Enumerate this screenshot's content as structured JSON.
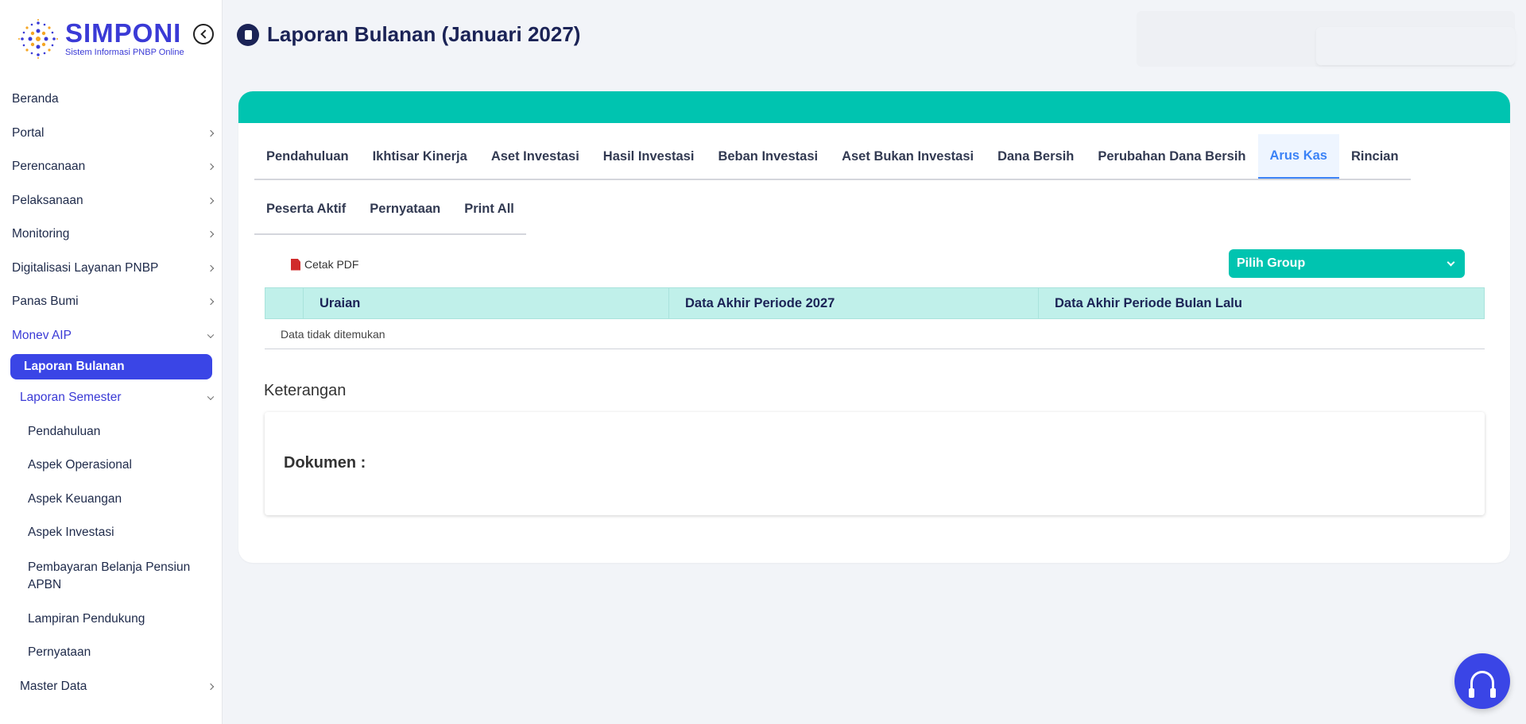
{
  "brand": {
    "title": "SIMPONI",
    "subtitle": "Sistem Informasi PNBP Online",
    "color": "#3a3ad6"
  },
  "sidebar": {
    "items": [
      {
        "label": "Beranda"
      },
      {
        "label": "Portal"
      },
      {
        "label": "Perencanaan"
      },
      {
        "label": "Pelaksanaan"
      },
      {
        "label": "Monitoring"
      },
      {
        "label": "Digitalisasi Layanan PNBP"
      },
      {
        "label": "Panas Bumi"
      },
      {
        "label": "Monev AIP"
      },
      {
        "label": "Laporan Bulanan"
      },
      {
        "label": "Laporan Semester"
      },
      {
        "label": "Pendahuluan"
      },
      {
        "label": "Aspek Operasional"
      },
      {
        "label": "Aspek Keuangan"
      },
      {
        "label": "Aspek Investasi"
      },
      {
        "label": "Pembayaran Belanja Pensiun APBN"
      },
      {
        "label": "Lampiran Pendukung"
      },
      {
        "label": "Pernyataan"
      },
      {
        "label": "Master Data"
      }
    ]
  },
  "header": {
    "title": "Laporan Bulanan (Januari 2027)"
  },
  "tabs": {
    "row1": [
      "Pendahuluan",
      "Ikhtisar Kinerja",
      "Aset Investasi",
      "Hasil Investasi",
      "Beban Investasi",
      "Aset Bukan Investasi",
      "Dana Bersih",
      "Perubahan Dana Bersih",
      "Arus Kas",
      "Rincian"
    ],
    "row2": [
      "Peserta Aktif",
      "Pernyataan",
      "Print All"
    ],
    "active": "Arus Kas"
  },
  "toolbar": {
    "cetak_pdf": "Cetak PDF",
    "group_select": "Pilih Group"
  },
  "table": {
    "columns": [
      "",
      "Uraian",
      "Data Akhir Periode 2027",
      "Data Akhir Periode Bulan Lalu"
    ],
    "empty_text": "Data tidak ditemukan"
  },
  "keterangan": {
    "label": "Keterangan",
    "dokumen": "Dokumen :"
  },
  "colors": {
    "accent_teal": "#00c4b0",
    "primary_blue": "#3a45e6",
    "active_tab": "#3b82f6",
    "table_header": "#c0f0ea"
  }
}
